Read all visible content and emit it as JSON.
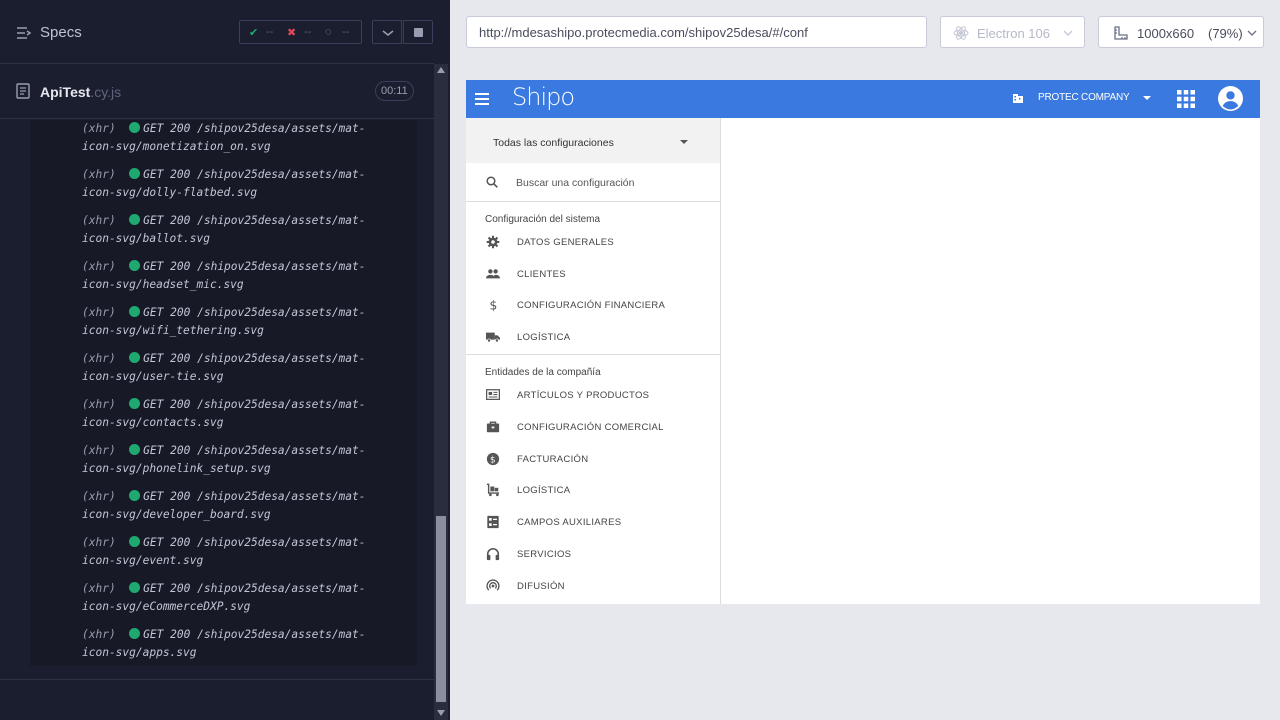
{
  "runner": {
    "specs_label": "Specs",
    "stats": {
      "passed": "--",
      "failed": "--",
      "pending": "--"
    },
    "file": {
      "name": "ApiTest",
      "ext": ".cy.js"
    },
    "duration": "00:11",
    "log": [
      {
        "type": "(xhr)",
        "method": "GET",
        "status": "200",
        "url_line1": "/shipov25desa/assets/mat-",
        "url_line2": "icon-svg/monetization_on.svg"
      },
      {
        "type": "(xhr)",
        "method": "GET",
        "status": "200",
        "url_line1": "/shipov25desa/assets/mat-",
        "url_line2": "icon-svg/dolly-flatbed.svg"
      },
      {
        "type": "(xhr)",
        "method": "GET",
        "status": "200",
        "url_line1": "/shipov25desa/assets/mat-",
        "url_line2": "icon-svg/ballot.svg"
      },
      {
        "type": "(xhr)",
        "method": "GET",
        "status": "200",
        "url_line1": "/shipov25desa/assets/mat-",
        "url_line2": "icon-svg/headset_mic.svg"
      },
      {
        "type": "(xhr)",
        "method": "GET",
        "status": "200",
        "url_line1": "/shipov25desa/assets/mat-",
        "url_line2": "icon-svg/wifi_tethering.svg"
      },
      {
        "type": "(xhr)",
        "method": "GET",
        "status": "200",
        "url_line1": "/shipov25desa/assets/mat-",
        "url_line2": "icon-svg/user-tie.svg"
      },
      {
        "type": "(xhr)",
        "method": "GET",
        "status": "200",
        "url_line1": "/shipov25desa/assets/mat-",
        "url_line2": "icon-svg/contacts.svg"
      },
      {
        "type": "(xhr)",
        "method": "GET",
        "status": "200",
        "url_line1": "/shipov25desa/assets/mat-",
        "url_line2": "icon-svg/phonelink_setup.svg"
      },
      {
        "type": "(xhr)",
        "method": "GET",
        "status": "200",
        "url_line1": "/shipov25desa/assets/mat-",
        "url_line2": "icon-svg/developer_board.svg"
      },
      {
        "type": "(xhr)",
        "method": "GET",
        "status": "200",
        "url_line1": "/shipov25desa/assets/mat-",
        "url_line2": "icon-svg/event.svg"
      },
      {
        "type": "(xhr)",
        "method": "GET",
        "status": "200",
        "url_line1": "/shipov25desa/assets/mat-",
        "url_line2": "icon-svg/eCommerceDXP.svg"
      },
      {
        "type": "(xhr)",
        "method": "GET",
        "status": "200",
        "url_line1": "/shipov25desa/assets/mat-",
        "url_line2": "icon-svg/apps.svg"
      }
    ]
  },
  "browser": {
    "url": "http://mdesashipo.protecmedia.com/shipov25desa/#/conf",
    "engine": "Electron 106",
    "viewport": "1000x660",
    "zoom": "(79%)"
  },
  "app": {
    "logo": "Shipo",
    "company": "PROTEC COMPANY",
    "config_select": "Todas las configuraciones",
    "search_placeholder": "Buscar una configuración",
    "sections": [
      {
        "title": "Configuración del sistema",
        "items": [
          {
            "label": "DATOS GENERALES",
            "icon": "gear-icon"
          },
          {
            "label": "CLIENTES",
            "icon": "people-icon"
          },
          {
            "label": "CONFIGURACIÓN FINANCIERA",
            "icon": "dollar-icon"
          },
          {
            "label": "LOGÍSTICA",
            "icon": "truck-icon"
          }
        ]
      },
      {
        "title": "Entidades de la compañía",
        "items": [
          {
            "label": "ARTÍCULOS Y PRODUCTOS",
            "icon": "newspaper-icon"
          },
          {
            "label": "CONFIGURACIÓN COMERCIAL",
            "icon": "briefcase-icon"
          },
          {
            "label": "FACTURACIÓN",
            "icon": "monetization-icon"
          },
          {
            "label": "LOGÍSTICA",
            "icon": "dolly-icon"
          },
          {
            "label": "CAMPOS AUXILIARES",
            "icon": "ballot-icon"
          },
          {
            "label": "SERVICIOS",
            "icon": "headset-icon"
          },
          {
            "label": "DIFUSIÓN",
            "icon": "broadcast-icon"
          }
        ]
      }
    ]
  },
  "colors": {
    "runner_bg": "#1b1e2e",
    "appbar": "#3a7ae0",
    "success": "#1fa971"
  }
}
